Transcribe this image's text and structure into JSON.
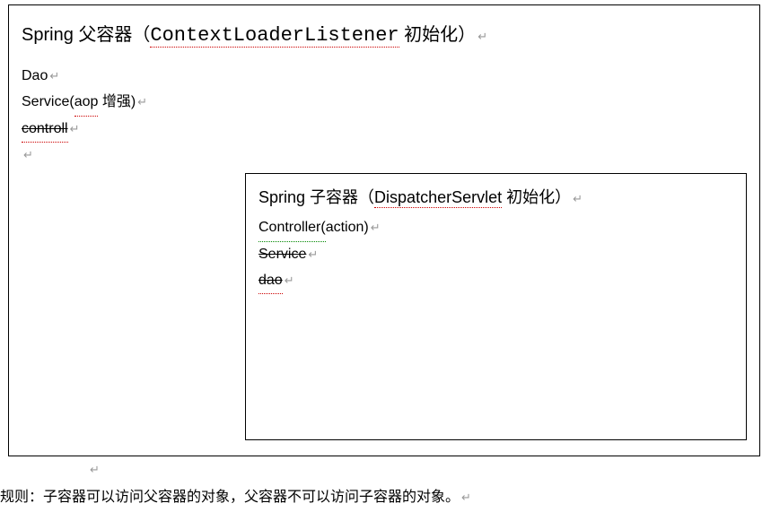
{
  "parent": {
    "title_prefix": "Spring 父容器（",
    "title_mono": "ContextLoaderListener",
    "title_suffix": " 初始化）",
    "line1": "Dao",
    "line2_a": "Service(",
    "line2_b": "aop",
    "line2_c": " 增强)",
    "line3": "controll"
  },
  "child": {
    "title_prefix": "Spring 子容器（",
    "title_mid": "DispatcherServlet",
    "title_suffix": " 初始化）",
    "line1_a": "Controller(",
    "line1_b": "action)",
    "line2": "Service",
    "line3": "dao"
  },
  "rule": "规则：子容器可以访问父容器的对象，父容器不可以访问子容器的对象。",
  "return_char": "↵"
}
